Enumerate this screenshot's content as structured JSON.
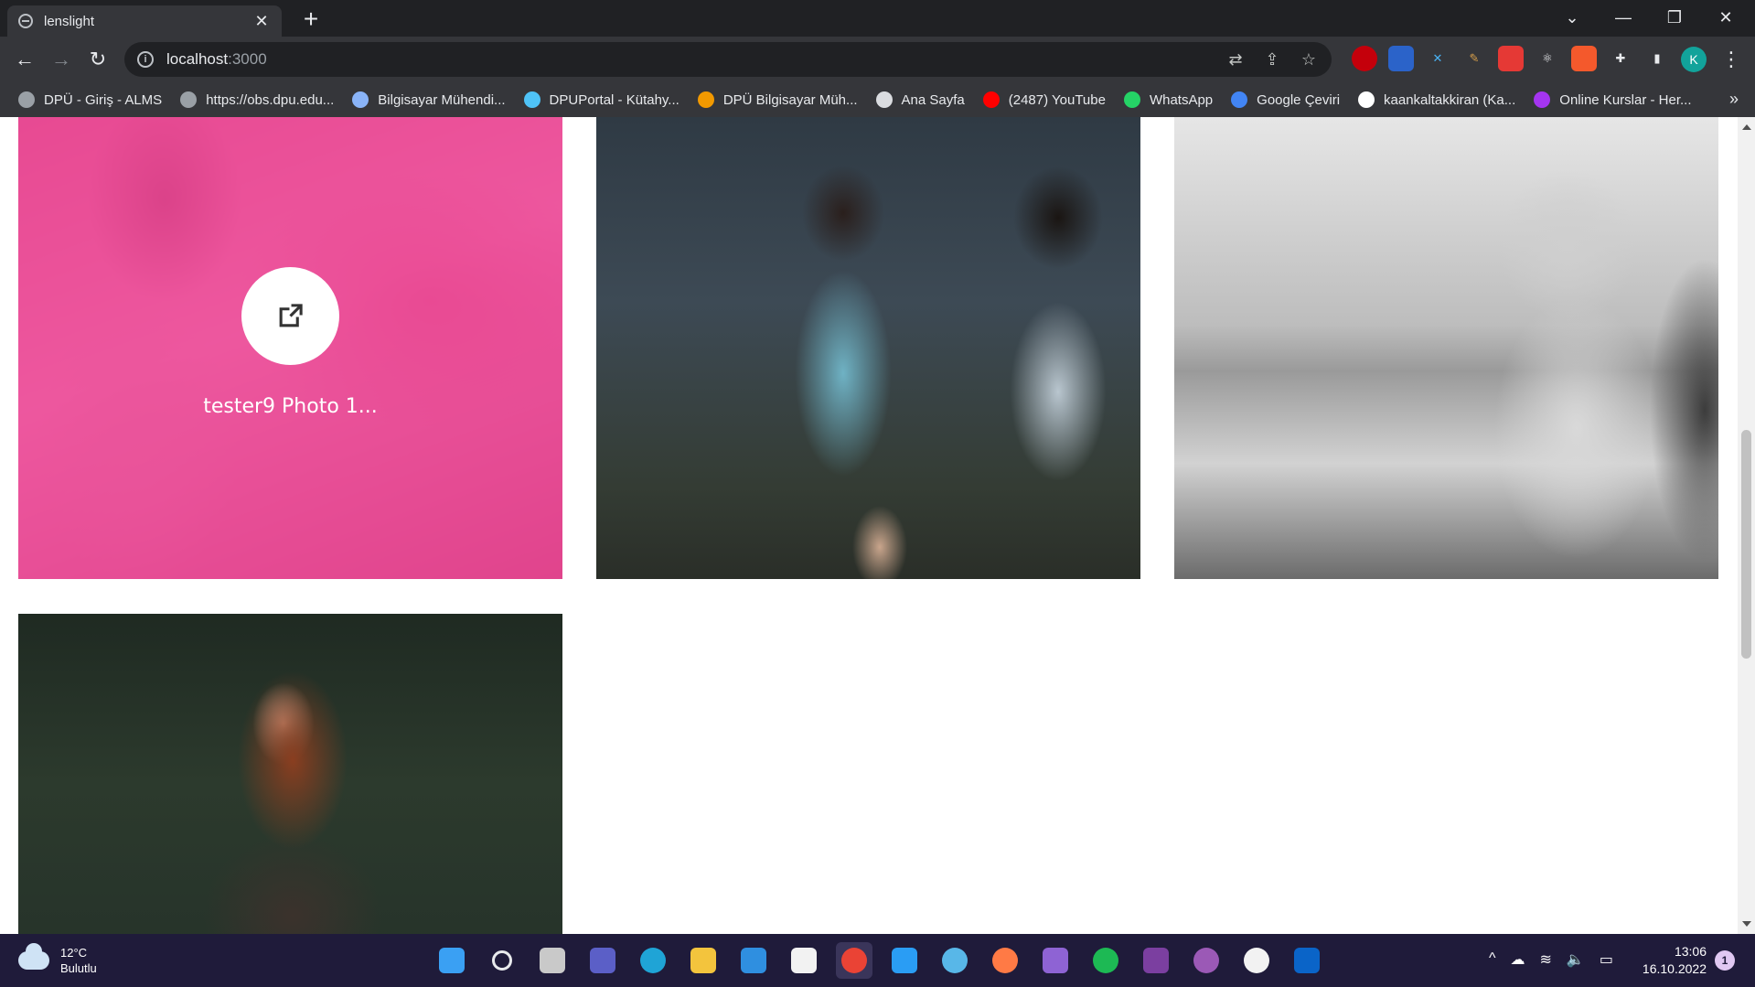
{
  "browser": {
    "tab": {
      "title": "lenslight",
      "close": "✕"
    },
    "new_tab": "+",
    "window_controls": {
      "tabsearch": "⌄",
      "minimize": "—",
      "restore": "❐",
      "close": "✕"
    },
    "nav": {
      "back": "←",
      "forward": "→",
      "reload": "↻"
    },
    "address": {
      "info": "i",
      "host": "localhost",
      "port": ":3000"
    },
    "profile_initial": "K"
  },
  "bookmarks": [
    {
      "label": "DPÜ - Giriş - ALMS",
      "color": "#9aa0a6"
    },
    {
      "label": "https://obs.dpu.edu...",
      "color": "#9aa0a6"
    },
    {
      "label": "Bilgisayar Mühendi...",
      "color": "#8ab4f8"
    },
    {
      "label": "DPUPortal - Kütahy...",
      "color": "#4fc3f7"
    },
    {
      "label": "DPÜ Bilgisayar Müh...",
      "color": "#f29900"
    },
    {
      "label": "Ana Sayfa",
      "color": "#dadce0"
    },
    {
      "label": "(2487) YouTube",
      "color": "#ff0000"
    },
    {
      "label": "WhatsApp",
      "color": "#25d366"
    },
    {
      "label": "Google Çeviri",
      "color": "#4285f4"
    },
    {
      "label": "kaankaltakkiran (Ka...",
      "color": "#ffffff"
    },
    {
      "label": "Online Kurslar - Her...",
      "color": "#a435f0"
    }
  ],
  "bookmarks_more": "»",
  "gallery": {
    "hovered_caption": "tester9 Photo 1...",
    "accent": "#f03c96"
  },
  "taskbar": {
    "weather": {
      "temp": "12°C",
      "condition": "Bulutlu"
    },
    "apps": [
      {
        "name": "start",
        "color": "#3aa0f3"
      },
      {
        "name": "search",
        "color": "#e8eaed"
      },
      {
        "name": "task-view",
        "color": "#c9c9c9"
      },
      {
        "name": "chat",
        "color": "#5b5fc7"
      },
      {
        "name": "edge",
        "color": "#1fa4d6"
      },
      {
        "name": "file-explorer",
        "color": "#f3c43d"
      },
      {
        "name": "mail",
        "color": "#2f8fe0"
      },
      {
        "name": "store",
        "color": "#f2f2f2"
      },
      {
        "name": "chrome",
        "color": "#ea4335"
      },
      {
        "name": "vscode",
        "color": "#2a9df4"
      },
      {
        "name": "paint",
        "color": "#58b7e8"
      },
      {
        "name": "app-orange",
        "color": "#ff7a45"
      },
      {
        "name": "visual-studio",
        "color": "#8e63d4"
      },
      {
        "name": "spotify",
        "color": "#1db954"
      },
      {
        "name": "arduino",
        "color": "#7b3fa0"
      },
      {
        "name": "github-desktop",
        "color": "#9b59b6"
      },
      {
        "name": "app-white",
        "color": "#f2f2f2"
      },
      {
        "name": "outlook",
        "color": "#0a64c8"
      }
    ],
    "tray_icons": [
      "^",
      "☁",
      "≋",
      "🔈",
      "▭"
    ],
    "time": "13:06",
    "date": "16.10.2022",
    "notifications": "1"
  }
}
